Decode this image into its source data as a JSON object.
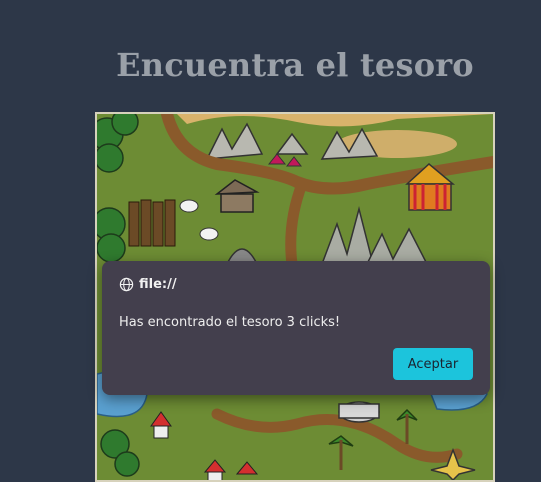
{
  "page": {
    "title": "Encuentra el tesoro"
  },
  "dialog": {
    "origin": "file://",
    "message": "Has encontrado el tesoro 3 clicks!",
    "accept_label": "Aceptar",
    "icon": "globe-icon"
  },
  "colors": {
    "background": "#2d3748",
    "dialog_bg": "#433f4d",
    "accent": "#1cc4dc",
    "map_grass": "#6d8c34"
  }
}
